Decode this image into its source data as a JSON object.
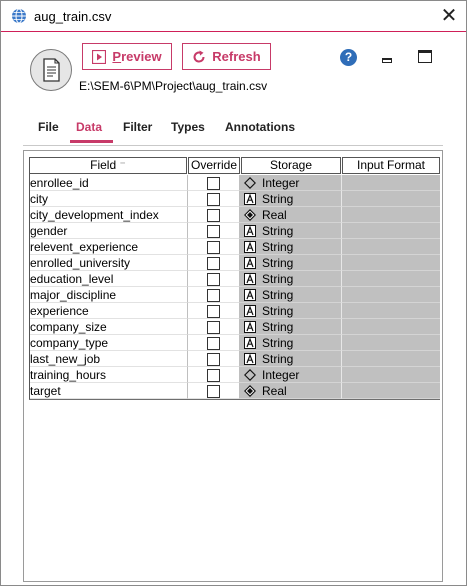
{
  "window": {
    "title": "aug_train.csv",
    "close_glyph": "✕"
  },
  "toolbar": {
    "preview_label": "review",
    "preview_mnemonic": "P",
    "refresh_label": "Refresh",
    "help_glyph": "?"
  },
  "file_path": "E:\\SEM-6\\PM\\Project\\aug_train.csv",
  "tabs": [
    {
      "label": "File",
      "active": false
    },
    {
      "label": "Data",
      "active": true
    },
    {
      "label": "Filter",
      "active": false
    },
    {
      "label": "Types",
      "active": false
    },
    {
      "label": "Annotations",
      "active": false
    }
  ],
  "table": {
    "headers": {
      "field": "Field",
      "sort_glyph": "⁻",
      "override": "Override",
      "storage": "Storage",
      "input_format": "Input Format"
    },
    "rows": [
      {
        "field": "enrollee_id",
        "override": false,
        "storage": "Integer",
        "storage_icon": "integer-icon",
        "input_format": ""
      },
      {
        "field": "city",
        "override": false,
        "storage": "String",
        "storage_icon": "string-icon",
        "input_format": ""
      },
      {
        "field": "city_development_index",
        "override": false,
        "storage": "Real",
        "storage_icon": "real-icon",
        "input_format": ""
      },
      {
        "field": "gender",
        "override": false,
        "storage": "String",
        "storage_icon": "string-icon",
        "input_format": ""
      },
      {
        "field": "relevent_experience",
        "override": false,
        "storage": "String",
        "storage_icon": "string-icon",
        "input_format": ""
      },
      {
        "field": "enrolled_university",
        "override": false,
        "storage": "String",
        "storage_icon": "string-icon",
        "input_format": ""
      },
      {
        "field": "education_level",
        "override": false,
        "storage": "String",
        "storage_icon": "string-icon",
        "input_format": ""
      },
      {
        "field": "major_discipline",
        "override": false,
        "storage": "String",
        "storage_icon": "string-icon",
        "input_format": ""
      },
      {
        "field": "experience",
        "override": false,
        "storage": "String",
        "storage_icon": "string-icon",
        "input_format": ""
      },
      {
        "field": "company_size",
        "override": false,
        "storage": "String",
        "storage_icon": "string-icon",
        "input_format": ""
      },
      {
        "field": "company_type",
        "override": false,
        "storage": "String",
        "storage_icon": "string-icon",
        "input_format": ""
      },
      {
        "field": "last_new_job",
        "override": false,
        "storage": "String",
        "storage_icon": "string-icon",
        "input_format": ""
      },
      {
        "field": "training_hours",
        "override": false,
        "storage": "Integer",
        "storage_icon": "integer-icon",
        "input_format": ""
      },
      {
        "field": "target",
        "override": false,
        "storage": "Real",
        "storage_icon": "real-icon",
        "input_format": ""
      }
    ]
  },
  "colors": {
    "accent": "#c73a68",
    "storage_cell_bg": "#c0c0c0",
    "help_blue": "#2f6db8"
  }
}
